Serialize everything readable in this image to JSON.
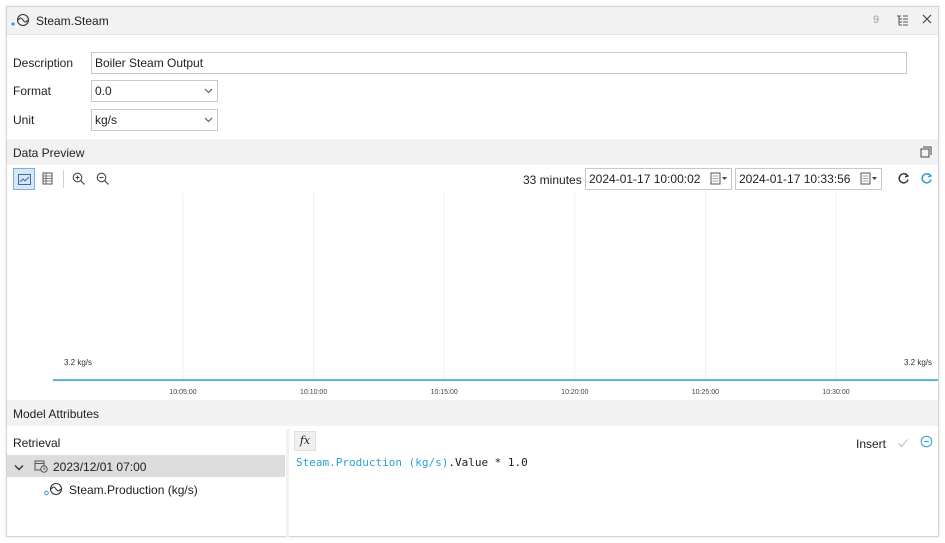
{
  "window": {
    "title": "Steam.Steam",
    "count": "9"
  },
  "form": {
    "description_label": "Description",
    "description_value": "Boiler Steam Output",
    "format_label": "Format",
    "format_value": "0.0",
    "unit_label": "Unit",
    "unit_value": "kg/s"
  },
  "data_preview": {
    "label": "Data Preview",
    "duration": "33 minutes",
    "start": "2024-01-17 10:00:02",
    "end": "2024-01-17 10:33:56"
  },
  "chart_data": {
    "type": "line",
    "series": [
      {
        "x": [
          "10:00:02",
          "10:33:56"
        ],
        "y": [
          3.2,
          3.2
        ]
      }
    ],
    "x_ticks": [
      "10:05:00",
      "10:10:00",
      "10:15:00",
      "10:20:00",
      "10:25:00",
      "10:30:00"
    ],
    "y_labels": {
      "left": "3.2 kg/s",
      "right": "3.2 kg/s"
    },
    "line_color": "#2aa1d6",
    "grid": true
  },
  "model_attributes": {
    "label": "Model Attributes",
    "retrieval_label": "Retrieval",
    "tree": {
      "root": "2023/12/01 07:00",
      "child": "Steam.Production (kg/s)"
    },
    "fx_label": "fx",
    "insert_label": "Insert",
    "expression": {
      "reference": "Steam.Production (kg/s)",
      "rest": ".Value * 1.0"
    }
  },
  "colors": {
    "accent": "#2aa1d6",
    "header_bg": "#f2f2f2"
  },
  "icons": {
    "title": "sensor-wave-icon",
    "tree": "tree-view-icon",
    "close": "close-icon",
    "chart": "line-chart-icon",
    "table": "table-icon",
    "zoom_in": "zoom-in-icon",
    "zoom_out": "zoom-out-icon",
    "refresh": "refresh-icon",
    "auto_refresh": "auto-refresh-icon",
    "popout": "popout-icon"
  }
}
